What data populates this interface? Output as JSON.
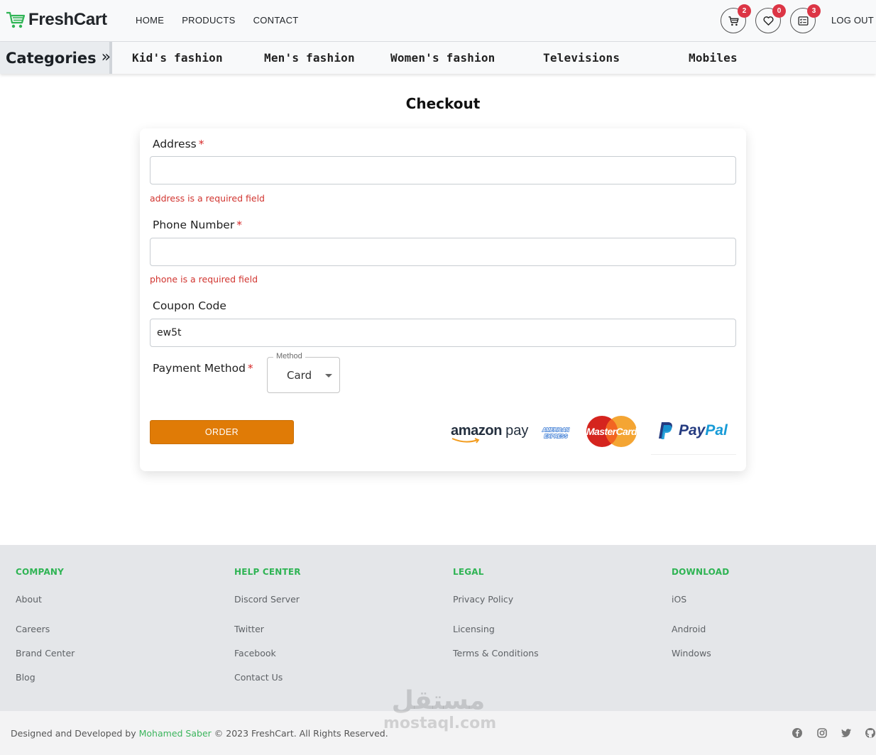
{
  "navbar": {
    "brand": "FreshCart",
    "links": [
      "HOME",
      "PRODUCTS",
      "CONTACT"
    ],
    "cart_count": "2",
    "wishlist_count": "0",
    "orders_count": "3",
    "logout": "LOG OUT"
  },
  "categories": {
    "heading": "Categories",
    "arrow": "»",
    "items": [
      "Kid's fashion",
      "Men's fashion",
      "Women's fashion",
      "Televisions",
      "Mobiles"
    ]
  },
  "checkout": {
    "title": "Checkout",
    "address": {
      "label": "Address",
      "required_mark": "*",
      "value": "",
      "error": "address is a required field"
    },
    "phone": {
      "label": "Phone Number",
      "required_mark": "*",
      "value": "",
      "error": "phone is a required field"
    },
    "coupon": {
      "label": "Coupon Code",
      "value": "ew5t"
    },
    "payment": {
      "label": "Payment Method",
      "required_mark": "*",
      "select_legend": "Method",
      "selected": "Card"
    },
    "order_button": "ORDER",
    "payment_logos": {
      "amazon_a": "amazon",
      "amazon_b": "pay",
      "amex": "AMERICAN EXPRESS",
      "mastercard": "MasterCard",
      "paypal_a": "Pay",
      "paypal_b": "Pal"
    },
    "colors": {
      "accent": "#e07b06",
      "error": "#d1342f"
    }
  },
  "footer": {
    "columns": [
      {
        "heading": "COMPANY",
        "links": [
          "About",
          "Careers",
          "Brand Center",
          "Blog"
        ]
      },
      {
        "heading": "HELP CENTER",
        "links": [
          "Discord Server",
          "Twitter",
          "Facebook",
          "Contact Us"
        ]
      },
      {
        "heading": "LEGAL",
        "links": [
          "Privacy Policy",
          "Licensing",
          "Terms & Conditions"
        ]
      },
      {
        "heading": "DOWNLOAD",
        "links": [
          "iOS",
          "Android",
          "Windows"
        ]
      }
    ],
    "copyright_prefix": "Designed and Developed by",
    "author": "Mohamed Saber",
    "copyright_suffix": "© 2023 FreshCart. All Rights Reserved.",
    "social_icons": [
      "facebook-icon",
      "instagram-icon",
      "twitter-icon",
      "github-icon"
    ],
    "heading_color": "#2fb454"
  },
  "watermark": {
    "arabic": "مستقل",
    "latin": "mostaql.com"
  }
}
